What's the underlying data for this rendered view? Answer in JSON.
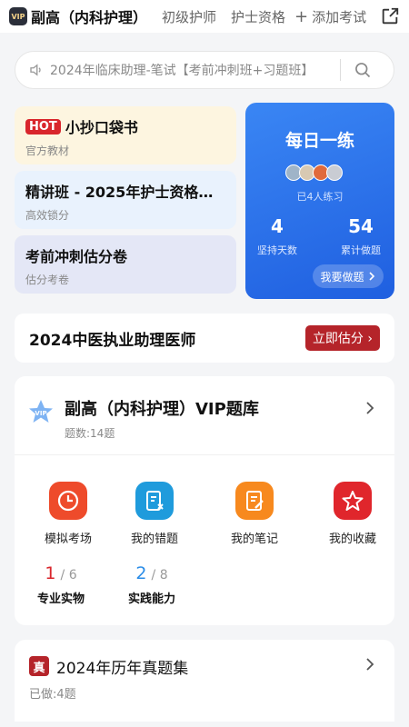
{
  "header": {
    "vip_badge": "VIP",
    "title": "副高（内科护理）",
    "tabs": [
      "初级护师",
      "护士资格"
    ],
    "add_label": "添加考试"
  },
  "search": {
    "placeholder": "2024年临床助理-笔试【考前冲刺班+习题班】"
  },
  "cards": [
    {
      "badge": "HOT",
      "title": "小抄口袋书",
      "subtitle": "官方教材"
    },
    {
      "title": "精讲班 - 2025年护士资格…",
      "subtitle": "高效锁分"
    },
    {
      "title": "考前冲刺估分卷",
      "subtitle": "估分考卷"
    }
  ],
  "daily": {
    "title": "每日一练",
    "practiced": "已4人练习",
    "stats": [
      {
        "value": "4",
        "label": "坚持天数"
      },
      {
        "value": "54",
        "label": "累计做题"
      }
    ],
    "button": "我要做题"
  },
  "estimate": {
    "title": "2024中医执业助理医师",
    "button": "立即估分"
  },
  "bank": {
    "badge": "VIP",
    "title": "副高（内科护理）VIP题库",
    "count": "题数:14题",
    "tools": [
      {
        "label": "模拟考场",
        "icon": "clock-icon",
        "color": "#ee4b2b"
      },
      {
        "label": "我的错题",
        "icon": "wrong-book-icon",
        "color": "#1f9bdc"
      },
      {
        "label": "我的笔记",
        "icon": "note-icon",
        "color": "#f7891e"
      },
      {
        "label": "我的收藏",
        "icon": "star-icon",
        "color": "#e0262c"
      }
    ],
    "progress": [
      {
        "done": "1",
        "total": "6",
        "label": "专业实物",
        "color": "#d9262c"
      },
      {
        "done": "2",
        "total": "8",
        "label": "实践能力",
        "color": "#2b8de8"
      }
    ]
  },
  "past_papers": {
    "badge": "真",
    "title": "2024年历年真题集",
    "done": "已做:4题"
  }
}
